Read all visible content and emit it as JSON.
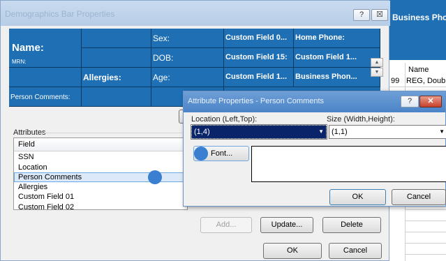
{
  "background_app": {
    "header_text": "Business Phor",
    "grid_header": "Name",
    "row": {
      "number": "99",
      "name": "REG, Double"
    }
  },
  "dialog": {
    "title": "Demographics Bar Properties",
    "help_label": "?",
    "close_label": "☒",
    "preview": {
      "r1": [
        "Name:",
        "",
        "Sex:",
        "Custom Field 0...",
        "Home Phone:"
      ],
      "r1_small": "MRN:",
      "r2": [
        "",
        "",
        "DOB:",
        "Custom Field 15:",
        "Custom Field 1..."
      ],
      "r3": [
        "",
        "Allergies:",
        "Age:",
        "Custom Field 1...",
        "Business Phon..."
      ],
      "r4": [
        "Person Comments:",
        "",
        "",
        "",
        ""
      ]
    },
    "attributes_label": "Attributes",
    "list_header": "Field",
    "list_items": [
      "SSN",
      "Location",
      "Person Comments",
      "Allergies",
      "Custom Field 01",
      "Custom Field 02"
    ],
    "add_label": "Add...",
    "update_label": "Update...",
    "delete_label": "Delete",
    "ok_label": "OK",
    "cancel_label": "Cancel"
  },
  "inner_dialog": {
    "title": "Attribute Properties - Person Comments",
    "help_label": "?",
    "close_label": "✕",
    "location_label": "Location (Left,Top):",
    "location_value": "(1,4)",
    "size_label": "Size (Width,Height):",
    "size_value": "(1,1)",
    "font_label": "Font...",
    "ok_label": "OK",
    "cancel_label": "Cancel"
  },
  "colors": {
    "accent": "#1f6fb5",
    "highlight": "#3b7fd0",
    "title_active": "#4b84c8"
  }
}
